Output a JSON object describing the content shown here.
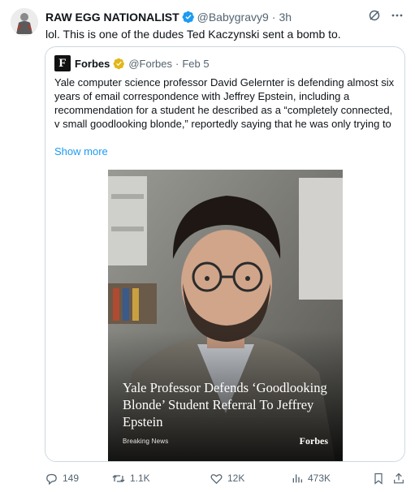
{
  "tweet": {
    "author_name": "RAW EGG NATIONALIST",
    "handle": "@Babygravy9",
    "separator": "·",
    "time": "3h",
    "text": "lol. This is one of the dudes Ted Kaczynski sent a bomb to.",
    "avatar_icon": "avatar-silhouette",
    "verified_icon": "verified-badge-blue",
    "header_icons": [
      "grok-icon",
      "more-icon"
    ]
  },
  "quote": {
    "logo_letter": "F",
    "author_name": "Forbes",
    "handle": "@Forbes",
    "separator": "·",
    "time": "Feb 5",
    "verified_icon": "verified-badge-gold",
    "text": "Yale computer science professor David Gelernter is defending almost six years of email correspondence with Jeffrey Epstein, including a recommendation for a student he described as a “completely connected, v small goodlooking blonde,” reportedly saying that he was only trying to",
    "show_more": "Show more",
    "image": {
      "headline": "Yale Professor Defends ‘Goodlooking Blonde’ Student Referral To Jeffrey Epstein",
      "breaking": "Breaking News",
      "brand": "Forbes"
    }
  },
  "actions": {
    "replies": "149",
    "retweets": "1.1K",
    "likes": "12K",
    "views": "473K",
    "icons": [
      "reply-icon",
      "retweet-icon",
      "like-icon",
      "views-icon",
      "bookmark-icon",
      "share-icon"
    ]
  },
  "colors": {
    "accent": "#1d9bf0",
    "secondary_text": "#536471",
    "border": "#cfd9de",
    "gold": "#e2b719"
  }
}
